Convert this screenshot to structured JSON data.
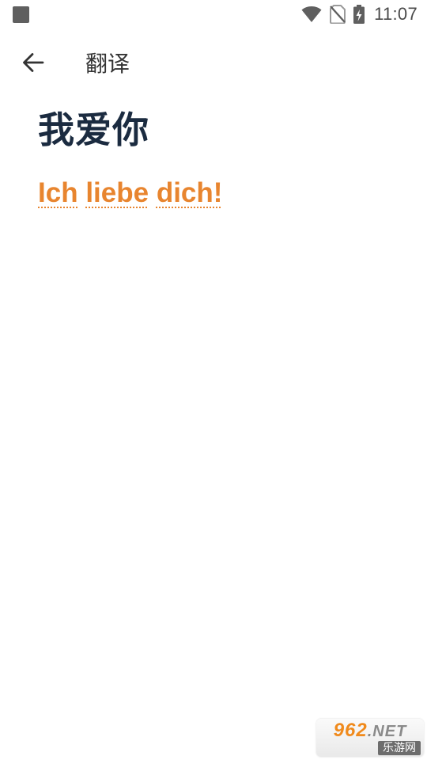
{
  "status_bar": {
    "time": "11:07",
    "icons": [
      "notification-square-icon",
      "wifi-icon",
      "no-sim-icon",
      "battery-charging-icon"
    ],
    "icon_color": "#5f5f5f"
  },
  "toolbar": {
    "back_icon": "arrow-left-icon",
    "title": "翻译"
  },
  "content": {
    "source_text": "我爱你",
    "translation_words": [
      "Ich",
      "liebe",
      "dich!"
    ],
    "source_color": "#1b2b40",
    "translation_color": "#e8852f"
  },
  "watermark": {
    "brand": "962",
    "suffix": ".NET",
    "site_name": "乐游网"
  }
}
